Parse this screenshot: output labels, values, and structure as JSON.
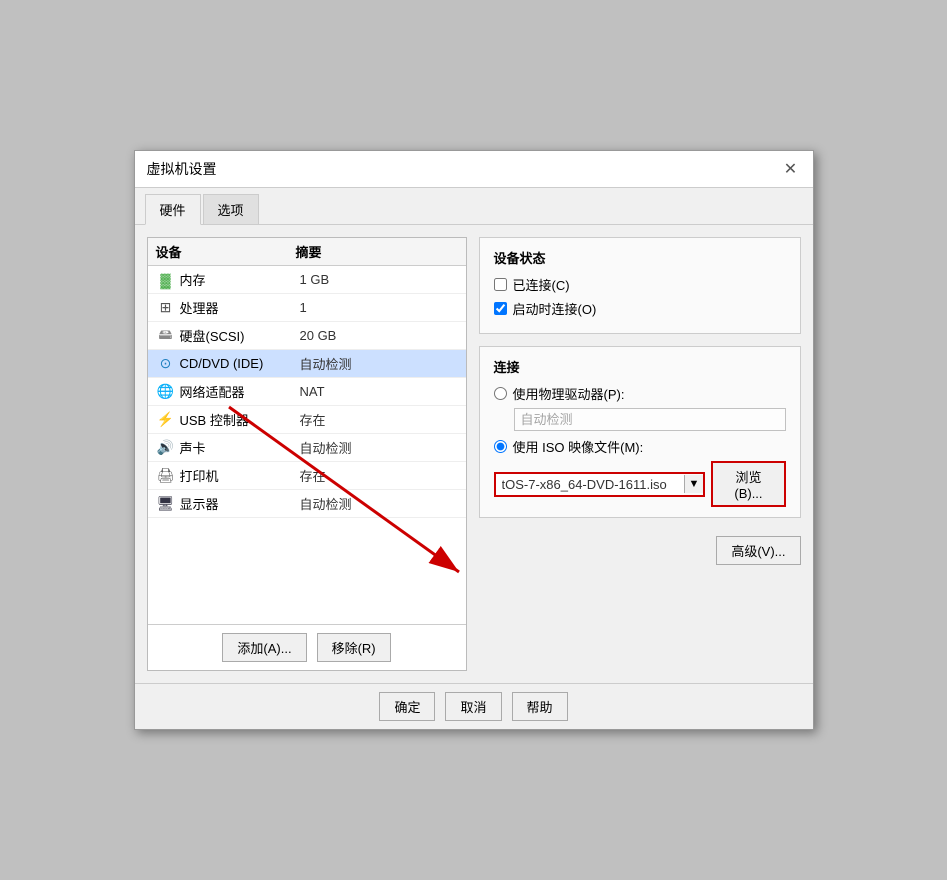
{
  "dialog": {
    "title": "虚拟机设置",
    "close_label": "✕"
  },
  "tabs": [
    {
      "label": "硬件",
      "active": true
    },
    {
      "label": "选项",
      "active": false
    }
  ],
  "device_table": {
    "headers": [
      "设备",
      "摘要"
    ],
    "rows": [
      {
        "icon": "🟩",
        "icon_type": "memory",
        "name": "内存",
        "summary": "1 GB",
        "selected": false
      },
      {
        "icon": "⬛",
        "icon_type": "cpu",
        "name": "处理器",
        "summary": "1",
        "selected": false
      },
      {
        "icon": "📁",
        "icon_type": "hdd",
        "name": "硬盘(SCSI)",
        "summary": "20 GB",
        "selected": false
      },
      {
        "icon": "💿",
        "icon_type": "cd",
        "name": "CD/DVD (IDE)",
        "summary": "自动检测",
        "selected": true
      },
      {
        "icon": "🌐",
        "icon_type": "net",
        "name": "网络适配器",
        "summary": "NAT",
        "selected": false
      },
      {
        "icon": "🔌",
        "icon_type": "usb",
        "name": "USB 控制器",
        "summary": "存在",
        "selected": false
      },
      {
        "icon": "🔊",
        "icon_type": "audio",
        "name": "声卡",
        "summary": "自动检测",
        "selected": false
      },
      {
        "icon": "🖨️",
        "icon_type": "printer",
        "name": "打印机",
        "summary": "存在",
        "selected": false
      },
      {
        "icon": "🖥️",
        "icon_type": "display",
        "name": "显示器",
        "summary": "自动检测",
        "selected": false
      }
    ]
  },
  "left_buttons": {
    "add_label": "添加(A)...",
    "remove_label": "移除(R)"
  },
  "device_status": {
    "section_title": "设备状态",
    "connected_label": "已连接(C)",
    "connected_checked": false,
    "connect_on_start_label": "启动时连接(O)",
    "connect_on_start_checked": true
  },
  "connection": {
    "section_title": "连接",
    "use_physical_label": "使用物理驱动器(P):",
    "use_physical_selected": false,
    "physical_dropdown_value": "自动检测",
    "use_iso_label": "使用 ISO 映像文件(M):",
    "use_iso_selected": true,
    "iso_value": "tOS-7-x86_64-DVD-1611.iso",
    "browse_label": "浏览(B)..."
  },
  "advanced_btn_label": "高级(V)...",
  "bottom_buttons": {
    "ok_label": "确定",
    "cancel_label": "取消",
    "help_label": "帮助"
  }
}
